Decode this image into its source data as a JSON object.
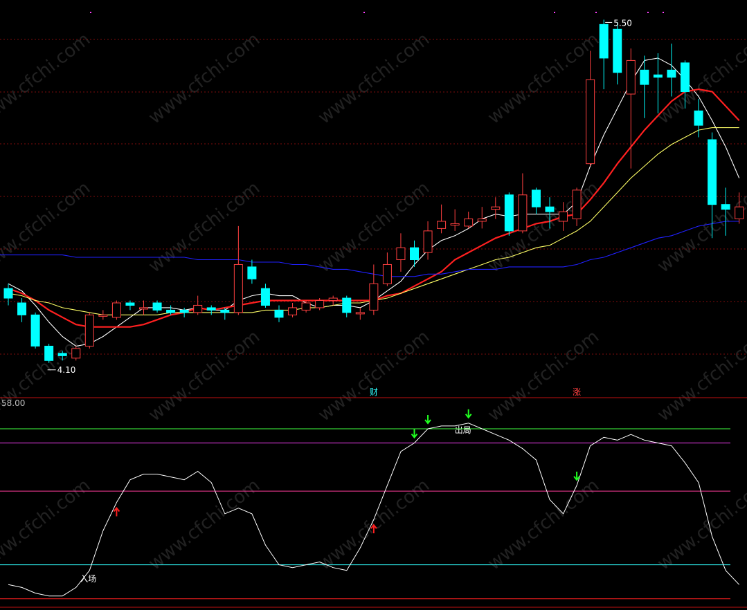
{
  "colors": {
    "background": "#000000",
    "candle_up": "#ff4040",
    "candle_down": "#00ffff",
    "ma5": "#ffffff",
    "ma10": "#ff2020",
    "ma20": "#ffff66",
    "ma60": "#2020ff",
    "grid": "#a01010",
    "panel_border": "#c01010",
    "osc_line": "#ffffff",
    "level_green": "#40ff40",
    "level_magenta": "#ff40ff",
    "level_pink": "#ff3c9c",
    "level_cyan": "#30ffff",
    "level_red": "#ff2020",
    "arrow_up": "#ff2020",
    "arrow_down": "#20ff20",
    "watermark": "#ffffff"
  },
  "main_panel": {
    "high_label": "5.50",
    "low_label": "4.10",
    "event_labels": [
      {
        "text": "财",
        "candle": 27,
        "color": "#30ffff"
      },
      {
        "text": "涨",
        "candle": 42,
        "color": "#ff4040"
      }
    ],
    "watermark": "www.cfchi.com"
  },
  "indicator_panel": {
    "scale_top_label": "58.00",
    "enter_label": "入场",
    "exit_label": "出局"
  },
  "chart_data": [
    {
      "type": "candlestick",
      "price_range": [
        4.0,
        5.55
      ],
      "candles": [
        {
          "o": 4.4,
          "c": 4.36,
          "h": 4.42,
          "l": 4.33
        },
        {
          "o": 4.34,
          "c": 4.29,
          "h": 4.36,
          "l": 4.26
        },
        {
          "o": 4.29,
          "c": 4.16,
          "h": 4.3,
          "l": 4.15
        },
        {
          "o": 4.16,
          "c": 4.1,
          "h": 4.17,
          "l": 4.09
        },
        {
          "o": 4.13,
          "c": 4.12,
          "h": 4.14,
          "l": 4.1
        },
        {
          "o": 4.11,
          "c": 4.15,
          "h": 4.16,
          "l": 4.1
        },
        {
          "o": 4.16,
          "c": 4.29,
          "h": 4.3,
          "l": 4.15
        },
        {
          "o": 4.29,
          "c": 4.29,
          "h": 4.31,
          "l": 4.27
        },
        {
          "o": 4.28,
          "c": 4.34,
          "h": 4.35,
          "l": 4.27
        },
        {
          "o": 4.34,
          "c": 4.33,
          "h": 4.35,
          "l": 4.31
        },
        {
          "o": 4.32,
          "c": 4.32,
          "h": 4.35,
          "l": 4.29
        },
        {
          "o": 4.34,
          "c": 4.31,
          "h": 4.35,
          "l": 4.3
        },
        {
          "o": 4.31,
          "c": 4.3,
          "h": 4.33,
          "l": 4.29
        },
        {
          "o": 4.31,
          "c": 4.3,
          "h": 4.32,
          "l": 4.28
        },
        {
          "o": 4.3,
          "c": 4.33,
          "h": 4.37,
          "l": 4.29
        },
        {
          "o": 4.32,
          "c": 4.31,
          "h": 4.33,
          "l": 4.29
        },
        {
          "o": 4.31,
          "c": 4.3,
          "h": 4.32,
          "l": 4.27
        },
        {
          "o": 4.3,
          "c": 4.5,
          "h": 4.66,
          "l": 4.29
        },
        {
          "o": 4.49,
          "c": 4.44,
          "h": 4.52,
          "l": 4.42
        },
        {
          "o": 4.4,
          "c": 4.33,
          "h": 4.42,
          "l": 4.32
        },
        {
          "o": 4.31,
          "c": 4.28,
          "h": 4.33,
          "l": 4.26
        },
        {
          "o": 4.29,
          "c": 4.32,
          "h": 4.34,
          "l": 4.28
        },
        {
          "o": 4.31,
          "c": 4.34,
          "h": 4.35,
          "l": 4.3
        },
        {
          "o": 4.32,
          "c": 4.35,
          "h": 4.36,
          "l": 4.31
        },
        {
          "o": 4.35,
          "c": 4.36,
          "h": 4.37,
          "l": 4.33
        },
        {
          "o": 4.36,
          "c": 4.3,
          "h": 4.37,
          "l": 4.28
        },
        {
          "o": 4.3,
          "c": 4.3,
          "h": 4.32,
          "l": 4.27
        },
        {
          "o": 4.31,
          "c": 4.42,
          "h": 4.5,
          "l": 4.29
        },
        {
          "o": 4.42,
          "c": 4.5,
          "h": 4.55,
          "l": 4.41
        },
        {
          "o": 4.52,
          "c": 4.57,
          "h": 4.63,
          "l": 4.47
        },
        {
          "o": 4.57,
          "c": 4.52,
          "h": 4.6,
          "l": 4.49
        },
        {
          "o": 4.55,
          "c": 4.64,
          "h": 4.68,
          "l": 4.52
        },
        {
          "o": 4.65,
          "c": 4.68,
          "h": 4.75,
          "l": 4.63
        },
        {
          "o": 4.67,
          "c": 4.67,
          "h": 4.73,
          "l": 4.64
        },
        {
          "o": 4.66,
          "c": 4.69,
          "h": 4.72,
          "l": 4.65
        },
        {
          "o": 4.68,
          "c": 4.69,
          "h": 4.74,
          "l": 4.65
        },
        {
          "o": 4.73,
          "c": 4.74,
          "h": 4.78,
          "l": 4.69
        },
        {
          "o": 4.79,
          "c": 4.64,
          "h": 4.8,
          "l": 4.62
        },
        {
          "o": 4.64,
          "c": 4.79,
          "h": 4.88,
          "l": 4.63
        },
        {
          "o": 4.81,
          "c": 4.74,
          "h": 4.82,
          "l": 4.71
        },
        {
          "o": 4.74,
          "c": 4.72,
          "h": 4.78,
          "l": 4.65
        },
        {
          "o": 4.68,
          "c": 4.72,
          "h": 4.76,
          "l": 4.64
        },
        {
          "o": 4.69,
          "c": 4.81,
          "h": 4.82,
          "l": 4.66
        },
        {
          "o": 4.92,
          "c": 5.27,
          "h": 5.39,
          "l": 4.91
        },
        {
          "o": 5.5,
          "c": 5.36,
          "h": 5.52,
          "l": 5.23
        },
        {
          "o": 5.48,
          "c": 5.3,
          "h": 5.51,
          "l": 5.25
        },
        {
          "o": 5.21,
          "c": 5.35,
          "h": 5.4,
          "l": 4.9
        },
        {
          "o": 5.31,
          "c": 5.25,
          "h": 5.37,
          "l": 5.11
        },
        {
          "o": 5.29,
          "c": 5.28,
          "h": 5.38,
          "l": 5.13
        },
        {
          "o": 5.31,
          "c": 5.28,
          "h": 5.42,
          "l": 5.2
        },
        {
          "o": 5.34,
          "c": 5.22,
          "h": 5.35,
          "l": 5.15
        },
        {
          "o": 5.14,
          "c": 5.08,
          "h": 5.19,
          "l": 5.03
        },
        {
          "o": 5.02,
          "c": 4.75,
          "h": 5.05,
          "l": 4.61
        },
        {
          "o": 4.75,
          "c": 4.73,
          "h": 4.82,
          "l": 4.62
        },
        {
          "o": 4.69,
          "c": 4.74,
          "h": 4.8,
          "l": 4.67
        }
      ],
      "moving_averages": [
        {
          "name": "MA5",
          "color": "#ffffff",
          "values": [
            4.42,
            4.39,
            4.33,
            4.26,
            4.2,
            4.16,
            4.17,
            4.2,
            4.24,
            4.28,
            4.32,
            4.32,
            4.32,
            4.31,
            4.32,
            4.31,
            4.31,
            4.35,
            4.37,
            4.38,
            4.37,
            4.37,
            4.34,
            4.32,
            4.33,
            4.33,
            4.32,
            4.35,
            4.39,
            4.43,
            4.5,
            4.56,
            4.6,
            4.62,
            4.65,
            4.69,
            4.71,
            4.7,
            4.71,
            4.71,
            4.71,
            4.71,
            4.76,
            4.91,
            5.04,
            5.15,
            5.26,
            5.35,
            5.36,
            5.33,
            5.27,
            5.2,
            5.1,
            4.99,
            4.86
          ]
        },
        {
          "name": "MA10",
          "color": "#ff2020",
          "values": [
            4.4,
            4.38,
            4.35,
            4.31,
            4.28,
            4.25,
            4.24,
            4.24,
            4.24,
            4.24,
            4.25,
            4.27,
            4.29,
            4.3,
            4.32,
            4.31,
            4.32,
            4.33,
            4.34,
            4.35,
            4.35,
            4.35,
            4.35,
            4.35,
            4.35,
            4.35,
            4.35,
            4.35,
            4.37,
            4.38,
            4.41,
            4.44,
            4.47,
            4.52,
            4.55,
            4.58,
            4.61,
            4.63,
            4.65,
            4.67,
            4.68,
            4.7,
            4.71,
            4.77,
            4.84,
            4.92,
            4.99,
            5.06,
            5.12,
            5.18,
            5.22,
            5.23,
            5.22,
            5.16,
            5.1
          ]
        },
        {
          "name": "MA20",
          "color": "#ffff66",
          "values": [
            4.38,
            4.37,
            4.35,
            4.34,
            4.32,
            4.31,
            4.3,
            4.29,
            4.29,
            4.29,
            4.29,
            4.29,
            4.3,
            4.3,
            4.3,
            4.3,
            4.3,
            4.3,
            4.3,
            4.31,
            4.31,
            4.31,
            4.32,
            4.32,
            4.33,
            4.34,
            4.34,
            4.35,
            4.36,
            4.38,
            4.4,
            4.42,
            4.44,
            4.46,
            4.48,
            4.5,
            4.52,
            4.53,
            4.55,
            4.57,
            4.58,
            4.61,
            4.64,
            4.68,
            4.74,
            4.8,
            4.86,
            4.91,
            4.96,
            5.0,
            5.03,
            5.06,
            5.07,
            5.07,
            5.07
          ]
        },
        {
          "name": "MA60",
          "color": "#2020ff",
          "values": [
            4.54,
            4.54,
            4.54,
            4.54,
            4.54,
            4.53,
            4.53,
            4.53,
            4.53,
            4.53,
            4.53,
            4.53,
            4.53,
            4.53,
            4.52,
            4.52,
            4.52,
            4.52,
            4.51,
            4.51,
            4.51,
            4.5,
            4.5,
            4.49,
            4.48,
            4.48,
            4.47,
            4.46,
            4.45,
            4.45,
            4.45,
            4.46,
            4.46,
            4.47,
            4.48,
            4.48,
            4.48,
            4.49,
            4.49,
            4.49,
            4.49,
            4.49,
            4.5,
            4.52,
            4.53,
            4.55,
            4.57,
            4.59,
            4.61,
            4.62,
            4.64,
            4.66,
            4.67,
            4.68,
            4.68
          ]
        }
      ]
    },
    {
      "type": "line",
      "name": "oscillator",
      "y_max": 58.0,
      "values": [
        3,
        2,
        0,
        -1,
        -1,
        2,
        8,
        22,
        32,
        40,
        42,
        42,
        41,
        40,
        43,
        39,
        28,
        30,
        28,
        17,
        10,
        9,
        10,
        11,
        9,
        8,
        16,
        26,
        38,
        50,
        53,
        58,
        59,
        59,
        60,
        58,
        56,
        54,
        51,
        47,
        33,
        28,
        38,
        52,
        55,
        54,
        56,
        54,
        53,
        52,
        46,
        39,
        20,
        8,
        3
      ],
      "levels": [
        {
          "value": 58.0,
          "color": "#40ff40"
        },
        {
          "value": 53.0,
          "color": "#ff40ff"
        },
        {
          "value": 36.0,
          "color": "#ff3c9c"
        },
        {
          "value": 10.0,
          "color": "#30ffff"
        },
        {
          "value": -2.0,
          "color": "#ff2020"
        }
      ],
      "buy_signals": [
        8,
        27
      ],
      "sell_signals": [
        30,
        31,
        34,
        42
      ],
      "enter_at": 6,
      "exit_at": 34
    }
  ]
}
